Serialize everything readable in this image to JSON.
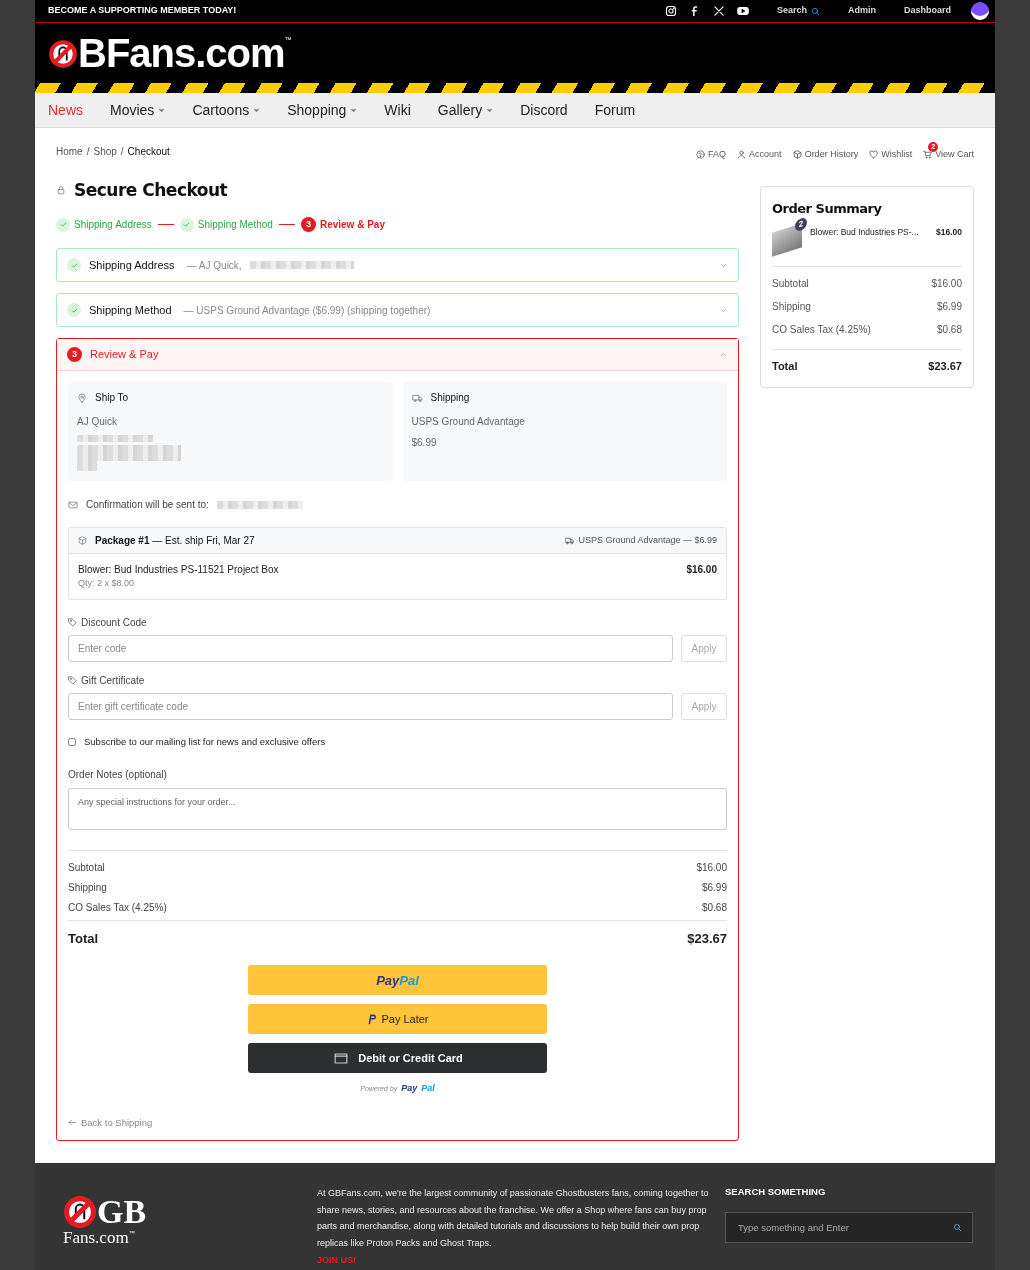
{
  "top_bar": {
    "promo": "BECOME A SUPPORTING MEMBER TODAY!",
    "search": "Search",
    "links": [
      "Admin",
      "Dashboard"
    ]
  },
  "logo": {
    "text": "BFans.com",
    "trademark": "™"
  },
  "nav": [
    {
      "label": "News",
      "selected": true,
      "dropdown": false
    },
    {
      "label": "Movies",
      "selected": false,
      "dropdown": true
    },
    {
      "label": "Cartoons",
      "selected": false,
      "dropdown": true
    },
    {
      "label": "Shopping",
      "selected": false,
      "dropdown": true
    },
    {
      "label": "Wiki",
      "selected": false,
      "dropdown": false
    },
    {
      "label": "Gallery",
      "selected": false,
      "dropdown": true
    },
    {
      "label": "Discord",
      "selected": false,
      "dropdown": false
    },
    {
      "label": "Forum",
      "selected": false,
      "dropdown": false
    }
  ],
  "breadcrumb": {
    "items": [
      "Home",
      "Shop",
      "Checkout"
    ],
    "separator": "/"
  },
  "account_links": [
    {
      "label": "FAQ",
      "kind": "help"
    },
    {
      "label": "Account",
      "kind": "account"
    },
    {
      "label": "Order History",
      "kind": "orders"
    },
    {
      "label": "Wishlist",
      "kind": "wishlist"
    },
    {
      "label": "View Cart",
      "kind": "cart",
      "badge": "2"
    }
  ],
  "title": "Secure Checkout",
  "steps": [
    {
      "label": "Shipping Address",
      "done": true
    },
    {
      "label": "Shipping Method",
      "done": true
    },
    {
      "label": "Review & Pay",
      "done": false,
      "number": "3"
    }
  ],
  "sections": [
    {
      "title": "Shipping Address",
      "summary": "— AJ Quick,",
      "done": true,
      "expanded": false,
      "redacted": true
    },
    {
      "title": "Shipping Method",
      "summary": "— USPS Ground Advantage ($6.99) (shipping together)",
      "done": true,
      "expanded": false,
      "redacted": false
    },
    {
      "title": "Review & Pay",
      "done": false,
      "number": "3",
      "expanded": true,
      "redacted": false
    }
  ],
  "review": {
    "ship_to": {
      "title": "Ship To",
      "name": "AJ Quick"
    },
    "shipping": {
      "title": "Shipping",
      "method": "USPS Ground Advantage",
      "price": "$6.99"
    },
    "confirmation": "Confirmation will be sent to:",
    "package": {
      "title": "Package #1",
      "estimate": "— Est. ship Fri, Mar 27",
      "carrier": "USPS Ground Advantage — $6.99",
      "item": "Blower: Bud Industries PS-11521 Project Box",
      "qty": "Qty: 2 x $8.00",
      "price": "$16.00"
    },
    "codes": [
      {
        "label": "Discount Code",
        "placeholder": "Enter code",
        "button": "Apply"
      },
      {
        "label": "Gift Certificate",
        "placeholder": "Enter gift certificate code",
        "button": "Apply"
      }
    ],
    "subscribe": {
      "label": "Subscribe to our mailing list for news and exclusive offers",
      "checked": false
    },
    "notes": {
      "label": "Order Notes (optional)",
      "placeholder": "Any special instructions for your order..."
    },
    "totals": [
      {
        "label": "Subtotal",
        "value": "$16.00"
      },
      {
        "label": "Shipping",
        "value": "$6.99"
      },
      {
        "label": "CO Sales Tax (4.25%)",
        "value": "$0.68"
      }
    ],
    "total": {
      "label": "Total",
      "value": "$23.67"
    },
    "payments": [
      {
        "kind": "paypal",
        "logo": [
          "Pay",
          "Pal"
        ]
      },
      {
        "kind": "paylater",
        "label": "Pay Later"
      },
      {
        "kind": "card",
        "label": "Debit or Credit Card"
      }
    ],
    "powered": {
      "text": "Powered by",
      "logo": [
        "Pay",
        "Pal"
      ]
    },
    "back": "Back to Shipping"
  },
  "order_summary": {
    "title": "Order Summary",
    "item": {
      "name": "Blower: Bud Industries PS-...",
      "qty": "2",
      "price": "$16.00"
    },
    "rows": [
      {
        "label": "Subtotal",
        "value": "$16.00"
      },
      {
        "label": "Shipping",
        "value": "$6.99"
      },
      {
        "label": "CO Sales Tax (4.25%)",
        "value": "$0.68"
      }
    ],
    "total": {
      "label": "Total",
      "value": "$23.67"
    }
  },
  "footer": {
    "logo": {
      "top": "GB",
      "bottom": "Fans.com",
      "trademark": "™"
    },
    "about": "At GBFans.com, we're the largest community of passionate Ghostbusters fans, coming together to share news, stories, and resources about the franchise. We offer a Shop where fans can buy prop parts and merchandise, along with detailed tutorials and discussions to help build their own prop replicas like Proton Packs and Ghost Traps.",
    "join": "JOIN US!",
    "search_title": "SEARCH SOMETHING",
    "search_placeholder": "Type something and Enter"
  }
}
